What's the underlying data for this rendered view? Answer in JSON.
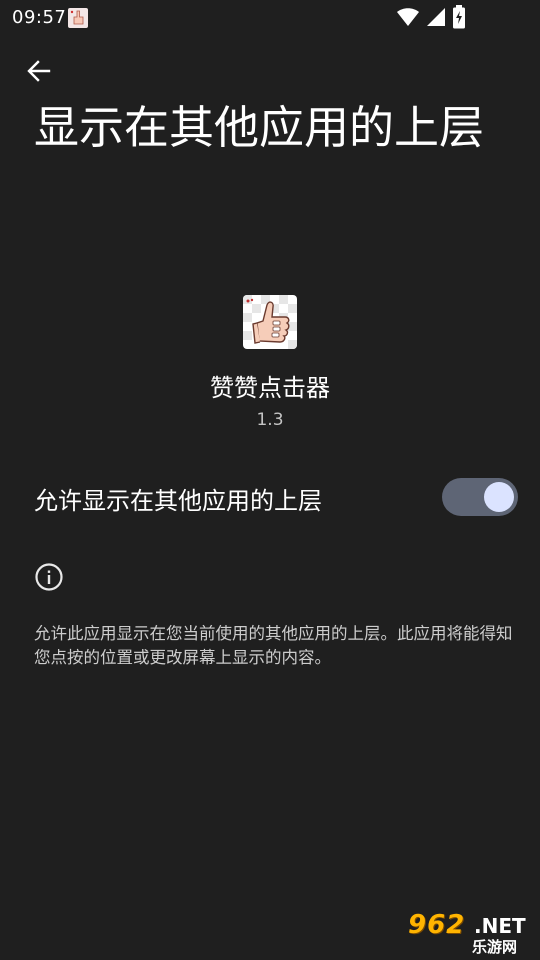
{
  "status_bar": {
    "time": "09:57",
    "icons": [
      "app-notification-icon",
      "wifi-icon",
      "signal-icon",
      "battery-charging-icon"
    ]
  },
  "header": {
    "back_icon": "arrow-left-icon",
    "title": "显示在其他应用的上层"
  },
  "app": {
    "icon": "thumbs-up-app-icon",
    "name": "赞赞点击器",
    "version": "1.3"
  },
  "permission": {
    "label": "允许显示在其他应用的上层",
    "enabled": true
  },
  "info": {
    "icon": "info-icon",
    "text": "允许此应用显示在您当前使用的其他应用的上层。此应用将能得知您点按的位置或更改屏幕上显示的内容。"
  },
  "watermark": {
    "brand": "962",
    "suffix": ".NET",
    "subtitle": "乐游网"
  },
  "colors": {
    "background": "#1f1f1f",
    "switch_track": "#5e6575",
    "switch_thumb": "#dbe3ff",
    "watermark": "#ffb400"
  }
}
